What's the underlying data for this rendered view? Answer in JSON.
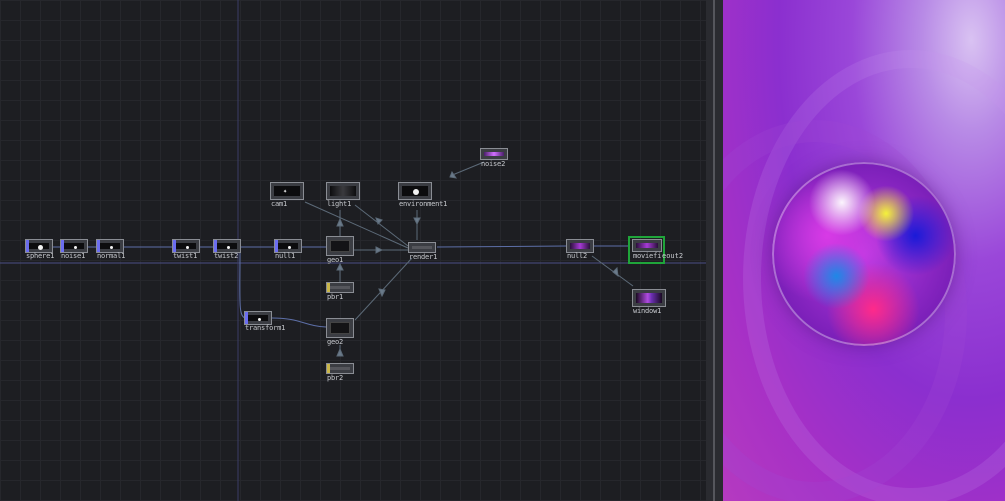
{
  "network": {
    "nodes": {
      "sphere1": "sphere1",
      "noise1": "noise1",
      "normal1": "normal1",
      "twist1": "twist1",
      "twist2": "twist2",
      "null1": "null1",
      "geo1": "geo1",
      "pbr1": "pbr1",
      "transform1": "transform1",
      "geo2": "geo2",
      "pbr2": "pbr2",
      "cam1": "cam1",
      "light1": "light1",
      "environment1": "environment1",
      "noise2": "noise2",
      "render1": "render1",
      "null2": "null2",
      "moviefileout": "moviefi",
      "moviefileout_suffix": "eout2",
      "window1": "window1"
    }
  },
  "colors": {
    "sop_flag": "#6b6df0",
    "material_flag": "#c9b649",
    "selected_outline": "#1fa53a"
  }
}
